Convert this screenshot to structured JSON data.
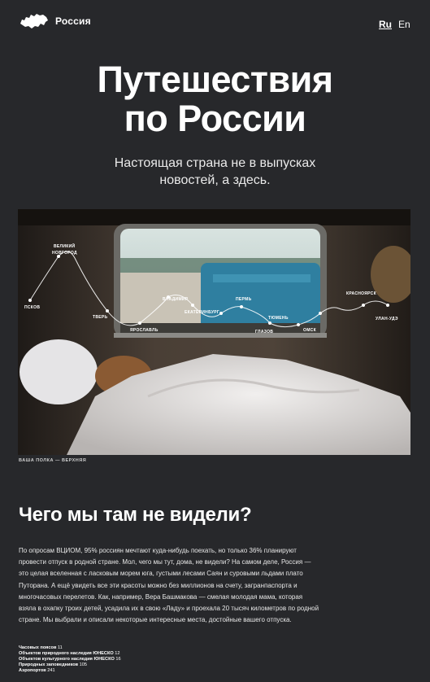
{
  "header": {
    "brand": "Россия",
    "lang": [
      "Ru",
      "En"
    ]
  },
  "hero": {
    "title_line1": "Путешествия",
    "title_line2": "по России",
    "subtitle_line1": "Настоящая страна не в выпусках",
    "subtitle_line2": "новостей, а здесь."
  },
  "map": {
    "cities": [
      "ВЕЛИКИЙ",
      "НОВГОРОД",
      "ПСКОВ",
      "ТВЕРЬ",
      "ЯРОСЛАВЛЬ",
      "ВЛАДИМИР",
      "ЕКАТЕРИНБУРГ",
      "ПЕРМЬ",
      "ГЛАЗОВ",
      "ТЮМЕНЬ",
      "ОМСК",
      "КРАСНОЯРСК",
      "УЛАН-УДЭ"
    ]
  },
  "caption": "ВАША ПОЛКА — ВЕРХНЯЯ",
  "section": {
    "title": "Чего мы там не видели?",
    "paragraph": "По опросам ВЦИОМ, 95% россиян мечтают куда-нибудь поехать, но только 36% планируют провести отпуск в родной стране. Мол, чего мы тут, дома, не видели? На самом деле, Россия — это целая вселенная с ласковым морем юга, густыми лесами Саян и суровыми льдами плато Путорана. А ещё увидеть все эти красоты можно без миллионов на счету, загранпаспорта и многочасовых перелетов. Как, например, Вера Башмакова — смелая молодая мама, которая взяла в охапку троих детей, усадила их в свою «Ладу» и проехала 20 тысяч километров по родной стране. Мы выбрали и описали некоторые интересные места, достойные вашего отпуска."
  },
  "stats": [
    {
      "label": "Часовых поясов",
      "value": "11"
    },
    {
      "label": "Объектов природного наследия ЮНЕСКО",
      "value": "12"
    },
    {
      "label": "Объектов культурного наследия ЮНЕСКО",
      "value": "16"
    },
    {
      "label": "Природных заповедников",
      "value": "105"
    },
    {
      "label": "Аэропортов",
      "value": "241"
    }
  ],
  "colors": {
    "background": "#27282b",
    "text": "#ffffff"
  }
}
